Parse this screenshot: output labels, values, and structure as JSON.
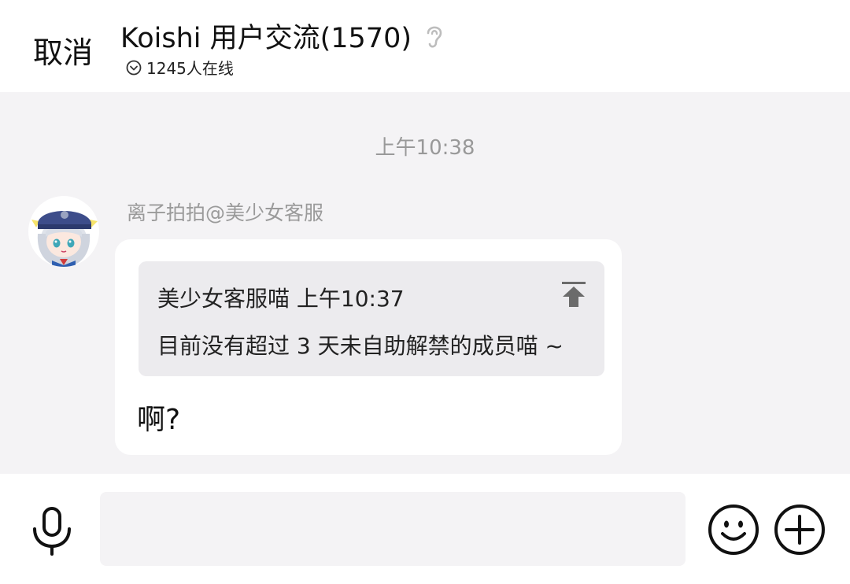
{
  "header": {
    "cancel_label": "取消",
    "group_title": "Koishi 用户交流(1570)",
    "online_text": "1245人在线"
  },
  "chat": {
    "time_divider": "上午10:38",
    "message": {
      "sender": "离子拍拍@美少女客服",
      "quote": {
        "author_time": "美少女客服喵 上午10:37",
        "text": "目前没有超过 3 天未自助解禁的成员喵 ~"
      },
      "text": "啊?"
    }
  },
  "input_bar": {
    "input_value": "",
    "input_placeholder": ""
  },
  "icons": {
    "ear": "ear-icon",
    "online_chevron": "chevron-down-circle-icon",
    "jump": "jump-to-top-icon",
    "mic": "microphone-icon",
    "emoji": "smiley-icon",
    "plus": "plus-circle-icon"
  },
  "colors": {
    "chat_background": "#f4f3f5",
    "quote_background": "#ecebee",
    "muted_text": "#999999"
  }
}
